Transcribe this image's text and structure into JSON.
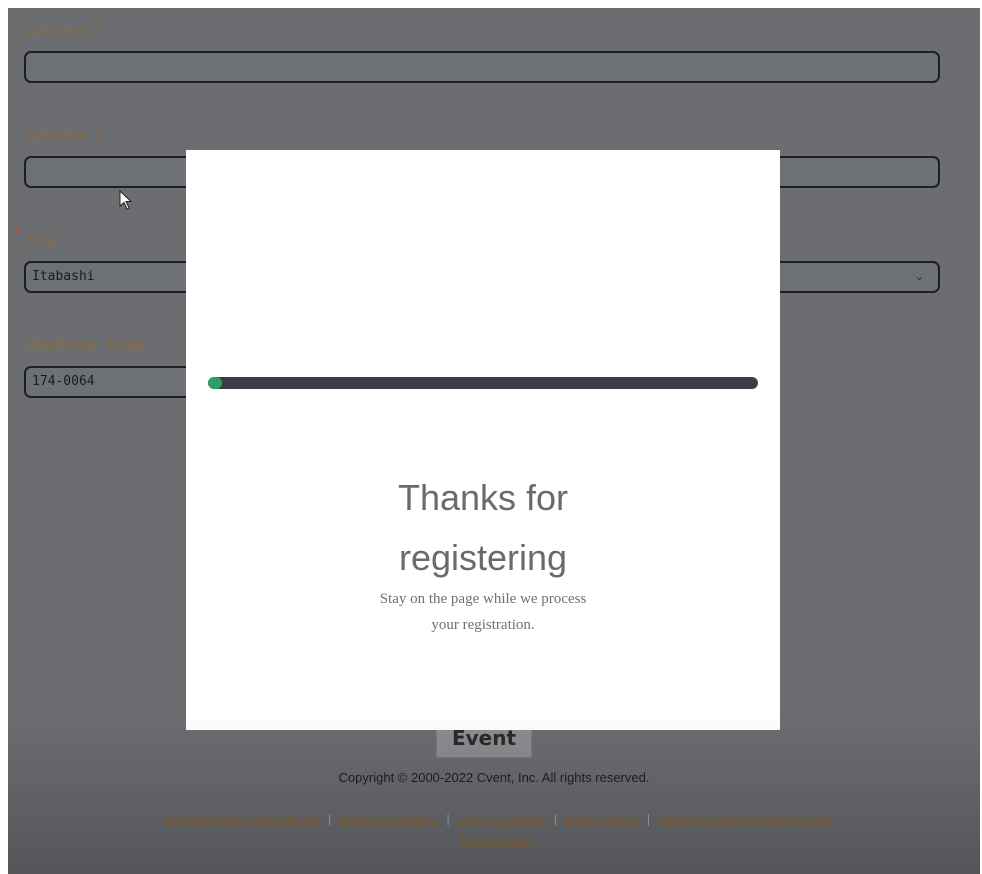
{
  "form": {
    "address2_label": "Address 2",
    "address2_value": "",
    "address3_label": "Address 3",
    "address3_value": "",
    "city_required_marker": "*",
    "city_label": "City",
    "city_value": "Itabashi",
    "zip_label": "Zip/Postal Code",
    "zip_value": "174-0064",
    "submit_label": "Event"
  },
  "footer": {
    "copyright": "Copyright © 2000-2022 Cvent, Inc. All rights reserved.",
    "links": [
      "Event Management Software",
      "Mobile Event Apps",
      "Survey Software",
      "Event Venues",
      "Strategic Meetings Management",
      "Privacy Policy"
    ],
    "separator": "|"
  },
  "modal": {
    "progress_fraction": 0.025,
    "title_line1": "Thanks for",
    "title_line2": "registering",
    "subtitle_line1": "Stay on the page while we process",
    "subtitle_line2": "your registration."
  },
  "colors": {
    "overlay_bg": "#6b6d71",
    "progress_fill": "#2f9e62",
    "progress_track": "#3a3d44",
    "label_accent": "#8a6a3e"
  }
}
